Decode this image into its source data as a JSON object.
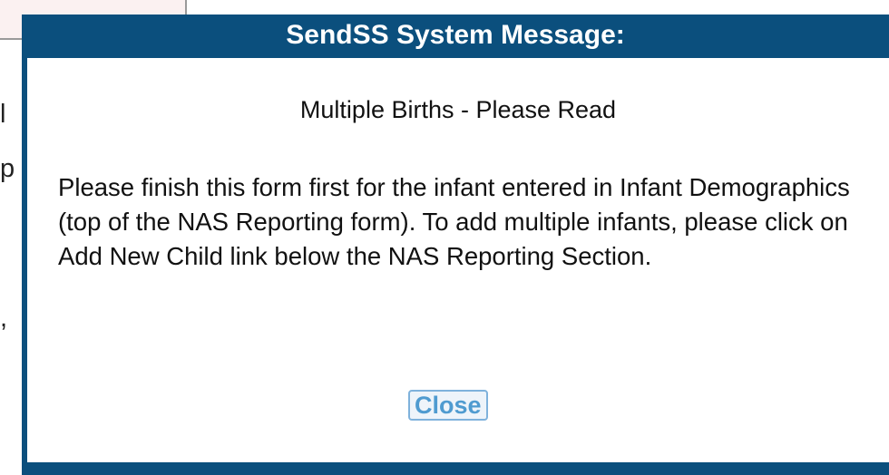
{
  "background": {
    "fragments": [
      "l",
      "p",
      ","
    ]
  },
  "dialog": {
    "title": "SendSS System Message:",
    "heading": "Multiple Births - Please Read",
    "message": "Please finish this form first for the infant entered in Infant Demographics (top of the NAS Reporting form). To add multiple infants, please click on Add New Child link below the NAS Reporting Section.",
    "close_label": "Close",
    "colors": {
      "frame": "#0b4f7d",
      "button_text": "#4f9bd0"
    }
  }
}
